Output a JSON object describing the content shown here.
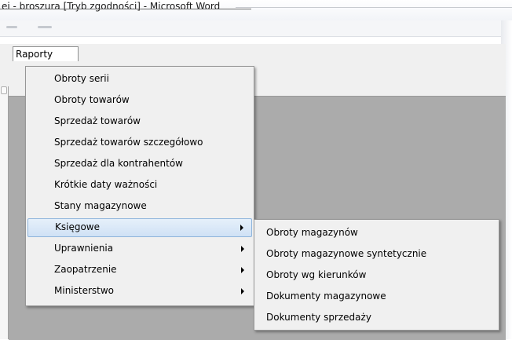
{
  "window_title": "ei - broszura [Tryb zgodności] - Microsoft Word",
  "menubar": {
    "raporty_label": "Raporty"
  },
  "main_menu": {
    "items": [
      {
        "label": "Obroty serii",
        "submenu": false
      },
      {
        "label": "Obroty towarów",
        "submenu": false
      },
      {
        "label": "Sprzedaż towarów",
        "submenu": false
      },
      {
        "label": "Sprzedaż towarów szczegółowo",
        "submenu": false
      },
      {
        "label": "Sprzedaż dla kontrahentów",
        "submenu": false
      },
      {
        "label": "Krótkie daty ważności",
        "submenu": false
      },
      {
        "label": "Stany magazynowe",
        "submenu": false
      },
      {
        "label": "Księgowe",
        "submenu": true,
        "active": true
      },
      {
        "label": "Uprawnienia",
        "submenu": true
      },
      {
        "label": "Zaopatrzenie",
        "submenu": true
      },
      {
        "label": "Ministerstwo",
        "submenu": true
      }
    ]
  },
  "submenu_ksiegowe": {
    "items": [
      {
        "label": "Obroty magazynów"
      },
      {
        "label": "Obroty magazynowe syntetycznie"
      },
      {
        "label": "Obroty wg kierunków"
      },
      {
        "label": "Dokumenty magazynowe"
      },
      {
        "label": "Dokumenty sprzedaży"
      }
    ]
  },
  "icons": {
    "submenu_arrow": "chevron-right-icon"
  },
  "colors": {
    "highlight_border": "#8fb5dc",
    "highlight_fill": "#cfe1f5",
    "menu_bg": "#f0f0f0",
    "workspace_bg": "#ababab"
  }
}
